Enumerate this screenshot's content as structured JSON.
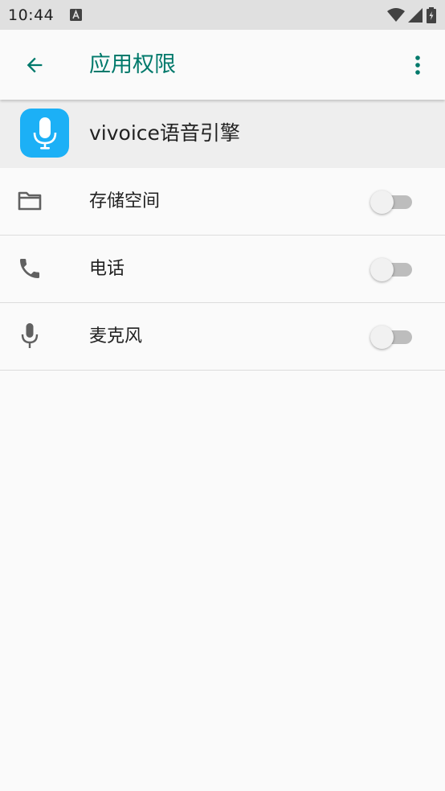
{
  "status_bar": {
    "time": "10:44",
    "notification_icon": "text-a-icon",
    "icons": [
      "wifi-icon",
      "cell-signal-icon",
      "battery-charging-icon"
    ]
  },
  "app_bar": {
    "title": "应用权限",
    "back_icon": "arrow-left-icon",
    "more_icon": "more-vert-icon",
    "accent_color": "#00796b"
  },
  "app": {
    "name": "vivoice语音引擎",
    "icon": "microphone-icon",
    "icon_color": "#1cb0f6"
  },
  "permissions": [
    {
      "label": "存储空间",
      "icon": "folder-icon",
      "enabled": false
    },
    {
      "label": "电话",
      "icon": "phone-icon",
      "enabled": false
    },
    {
      "label": "麦克风",
      "icon": "microphone-icon",
      "enabled": false
    }
  ]
}
